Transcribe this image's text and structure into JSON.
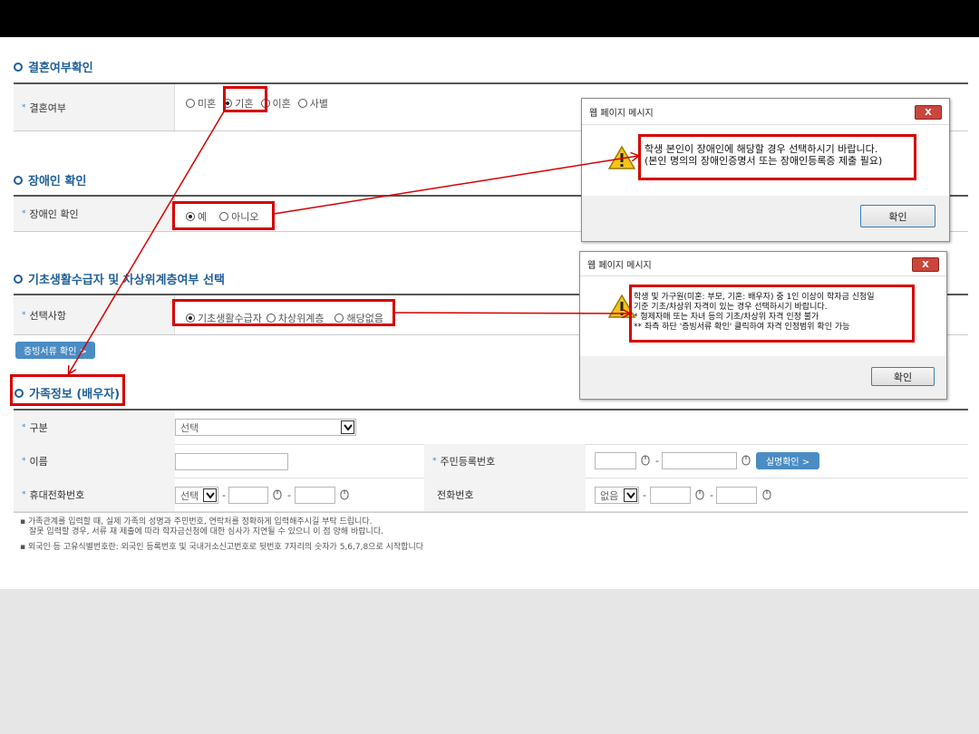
{
  "marriage": {
    "title": "결혼여부확인",
    "label": "결혼여부",
    "options": [
      "미혼",
      "기혼",
      "이혼",
      "사별"
    ],
    "selected": "기혼"
  },
  "disability": {
    "title": "장애인 확인",
    "label": "장애인 확인",
    "options": [
      "예",
      "아니오"
    ],
    "selected": "예"
  },
  "welfare": {
    "title": "기초생활수급자 및 차상위계층여부 선택",
    "label": "선택사항",
    "options": [
      "기초생활수급자",
      "차상위계층",
      "해당없음"
    ],
    "selected": "기초생활수급자",
    "doc_button": "증빙서류 확인 >"
  },
  "family": {
    "title": "가족정보 (배우자)",
    "division_label": "구분",
    "division_value": "선택",
    "name_label": "이름",
    "rrn_label": "주민등록번호",
    "verify_button": "실명확인 >",
    "mobile_label": "휴대전화번호",
    "mobile_select": "선택",
    "phone_label": "전화번호",
    "phone_select": "없음",
    "dash": "-"
  },
  "notes": [
    "가족관계를 입력할 때, 실제 가족의 성명과 주민번호, 연락처를 정확하게 입력해주시길 부탁 드립니다.",
    "잘못 입력할 경우, 서류 재 제출에 따라 학자금신청에 대한 심사가 지연될 수 있으니 이 점 양해 바랍니다.",
    "외국인 등 고유식별번호란: 외국인 등록번호 및 국내거소신고번호로 뒷번호 7자리의 숫자가 5,6,7,8으로 시작합니다"
  ],
  "dialog1": {
    "title": "웹 페이지 메시지",
    "close": "X",
    "lines": [
      "학생 본인이 장애인에 해당할 경우 선택하시기 바랍니다.",
      "(본인 명의의 장애인증명서 또는 장애인등록증 제출 필요)"
    ],
    "ok": "확인"
  },
  "dialog2": {
    "title": "웹 페이지 메시지",
    "close": "X",
    "lines": [
      "학생 및 가구원(미혼: 부모, 기혼: 배우자) 중 1인 이상이 학자금 신청일",
      "기준 기초/차상위 자격이 있는 경우 선택하시기 바랍니다.",
      "* 형제자매 또는 자녀 등의 기초/차상위 자격 인정 불가",
      "** 좌측 하단 '증빙서류 확인' 클릭하여 자격 인정범위 확인 가능"
    ],
    "ok": "확인"
  },
  "colors": {
    "accent": "#1f5f98",
    "highlight": "#d50000",
    "button": "#4a8cc4"
  }
}
